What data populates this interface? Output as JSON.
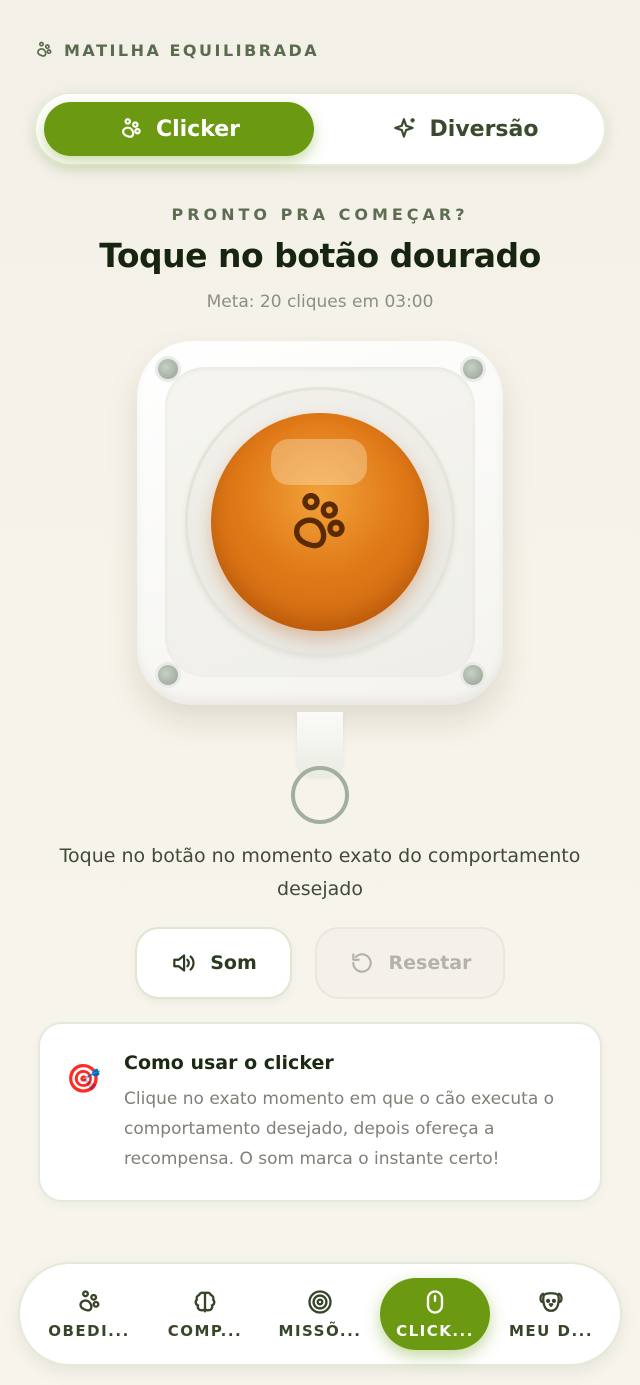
{
  "brand": {
    "title": "MATILHA EQUILIBRADA",
    "icon": "paw-icon"
  },
  "mode_tabs": [
    {
      "label": "Clicker",
      "icon": "paw-icon",
      "active": true
    },
    {
      "label": "Diversão",
      "icon": "sparkles-icon",
      "active": false
    }
  ],
  "status": {
    "eyebrow": "PRONTO PRA COMEÇAR?",
    "headline": "Toque no botão dourado",
    "goal": "Meta: 20 cliques em 03:00"
  },
  "clicker": {
    "button_icon": "paw-icon",
    "button_color": "#e07a18"
  },
  "instruction": "Toque no botão no momento exato do comportamento desejado",
  "actions": {
    "sound_label": "Som",
    "sound_icon": "volume-icon",
    "reset_label": "Resetar",
    "reset_icon": "reset-icon",
    "reset_enabled": false
  },
  "info": {
    "emoji": "🎯",
    "title": "Como usar o clicker",
    "text": "Clique no exato momento em que o cão executa o comportamento desejado, depois ofereça a recompensa. O som marca o instante certo!"
  },
  "nav": [
    {
      "label": "OBEDI...",
      "icon": "paw-icon",
      "active": false
    },
    {
      "label": "COMP...",
      "icon": "brain-icon",
      "active": false
    },
    {
      "label": "MISSÕ...",
      "icon": "target-icon",
      "active": false
    },
    {
      "label": "CLICK...",
      "icon": "mouse-icon",
      "active": true
    },
    {
      "label": "MEU D...",
      "icon": "dog-icon",
      "active": false
    }
  ],
  "colors": {
    "accent": "#6b9a12",
    "text_dark": "#17240f",
    "button_orange": "#e07a18"
  }
}
